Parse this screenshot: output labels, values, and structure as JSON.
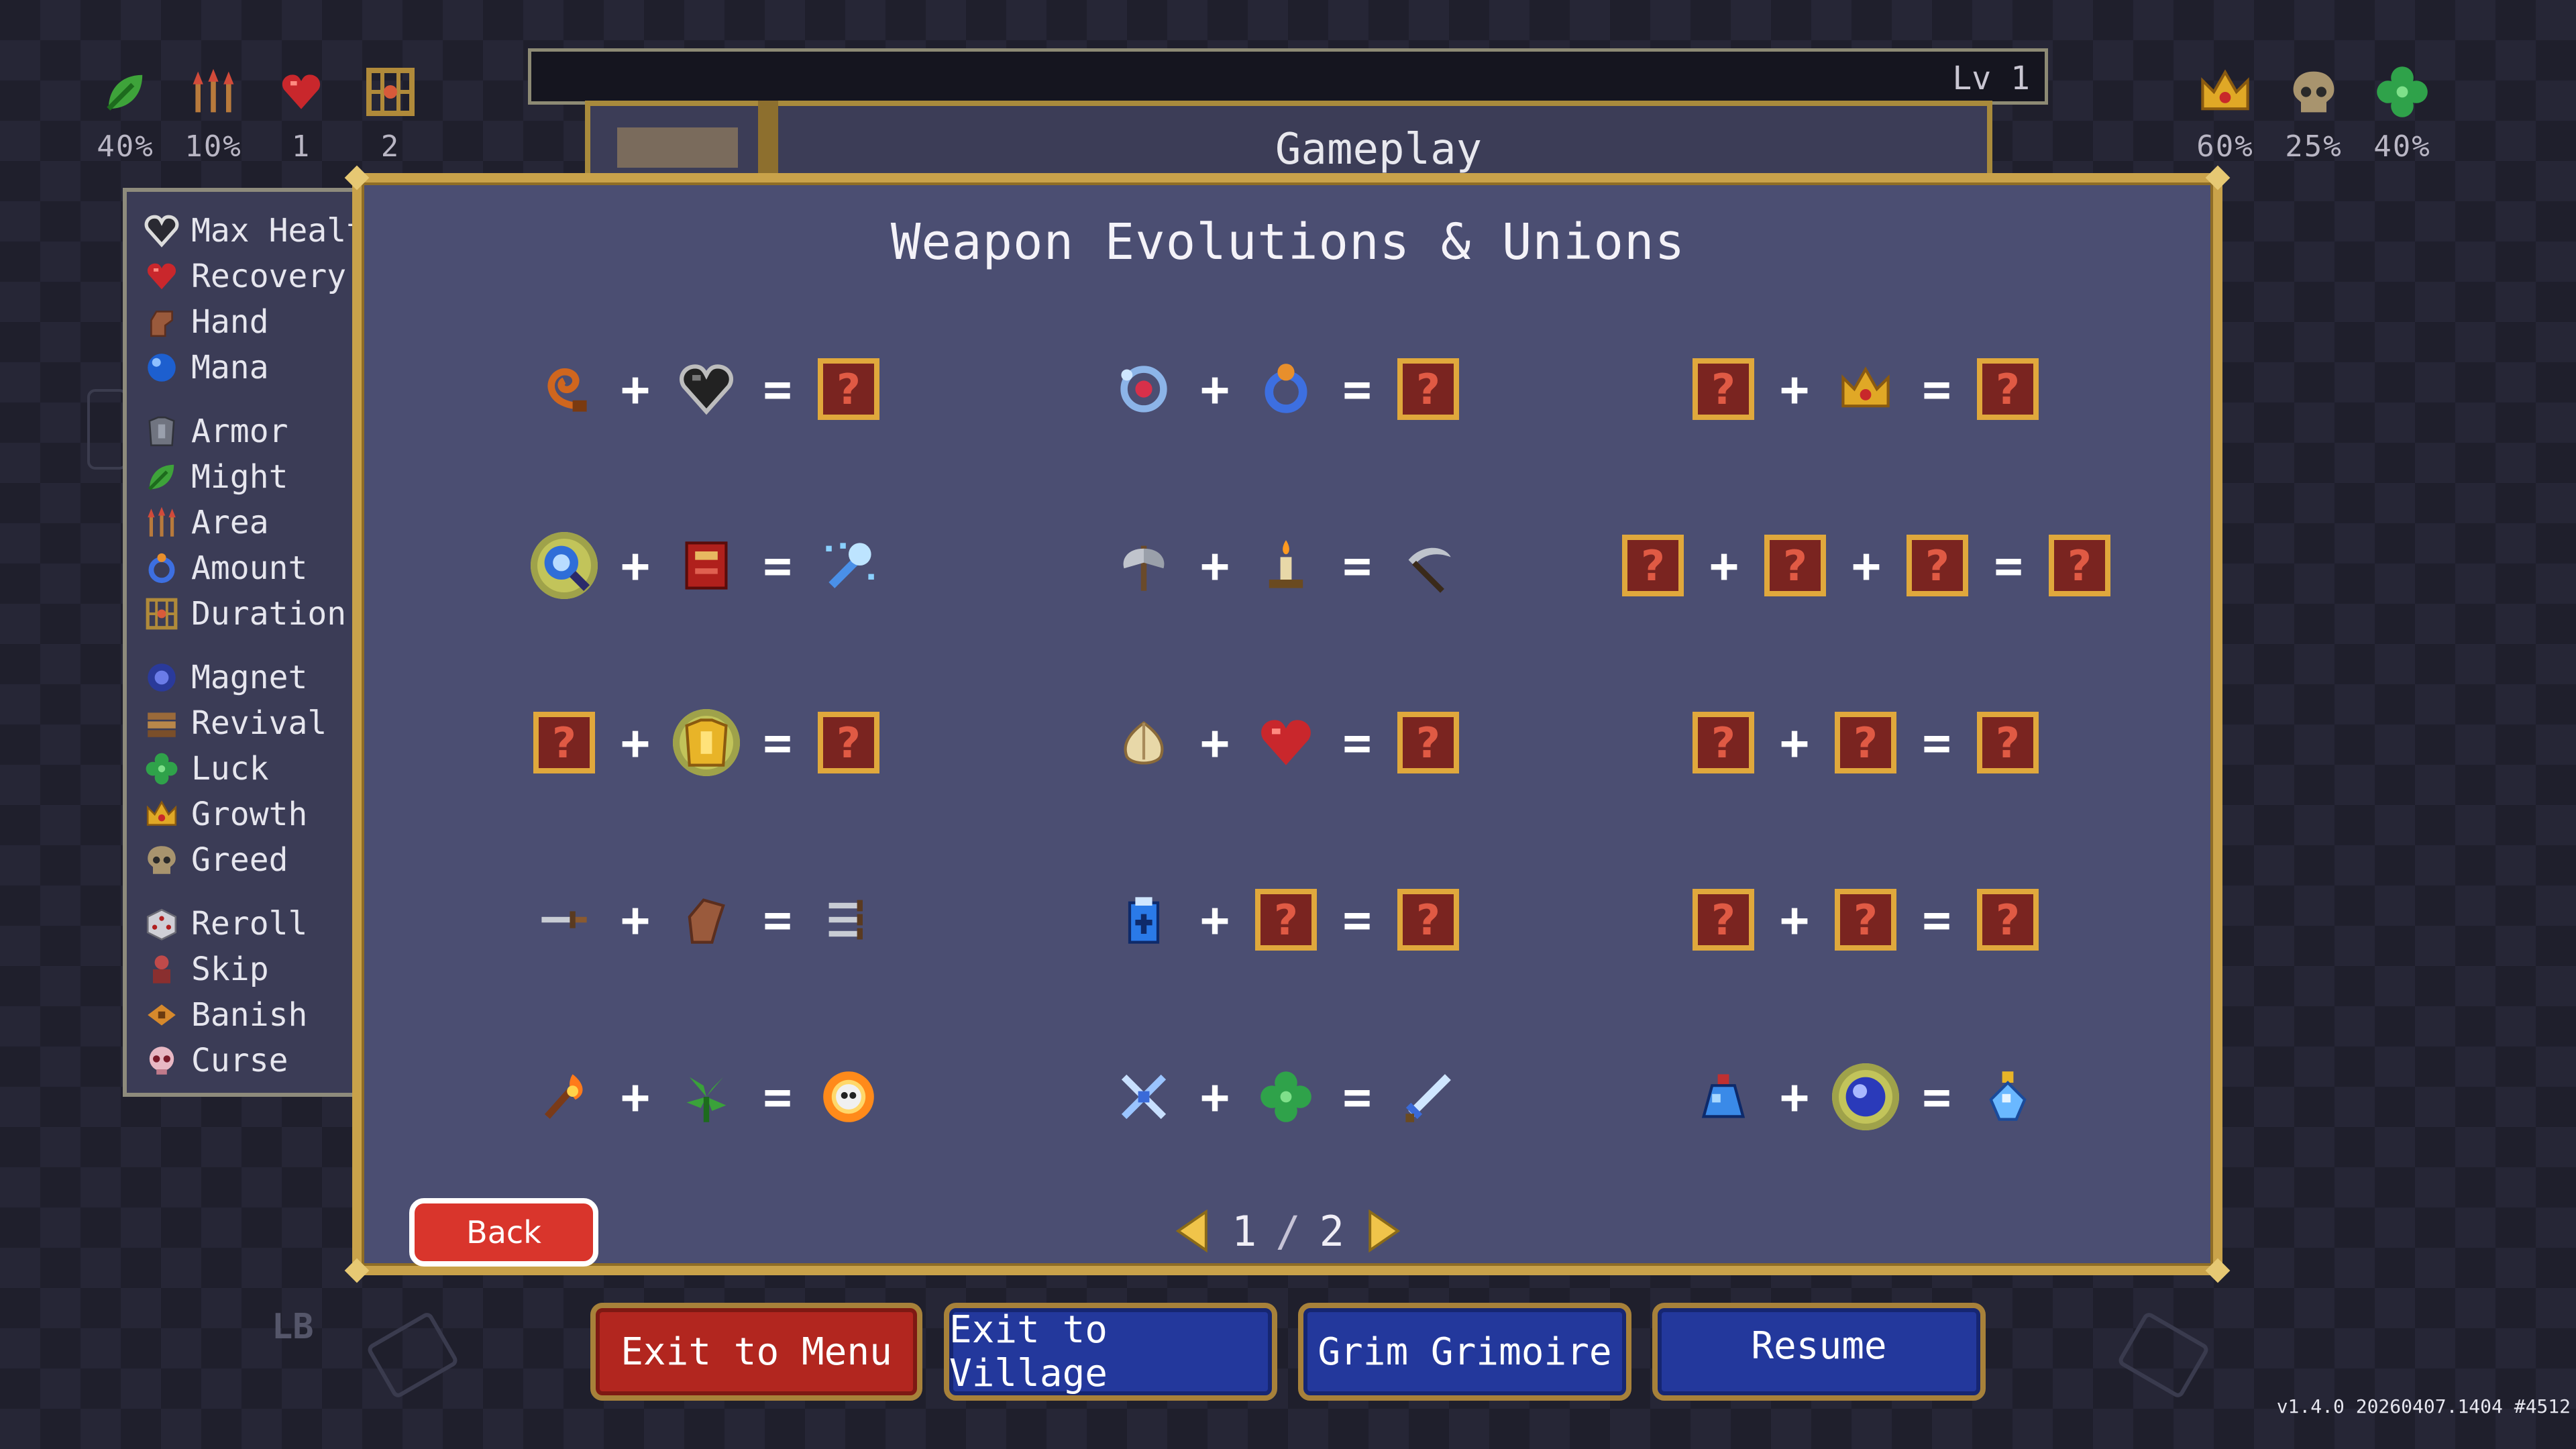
{
  "hud": {
    "left_stats": [
      {
        "icon": "leaf-icon",
        "value": "40%"
      },
      {
        "icon": "tridents-icon",
        "value": "10%"
      },
      {
        "icon": "heart-icon",
        "value": "1"
      },
      {
        "icon": "cage-icon",
        "value": "2"
      }
    ],
    "right_stats": [
      {
        "icon": "crown-icon",
        "value": "60%"
      },
      {
        "icon": "skull-icon",
        "value": "25%"
      },
      {
        "icon": "clover-icon",
        "value": "40%"
      }
    ],
    "level_label": "Lv 1"
  },
  "background_tab_title": "Gameplay",
  "stats_panel": {
    "items": [
      {
        "icon": "heart-outline-icon",
        "label": "Max Healt"
      },
      {
        "icon": "heart-icon",
        "label": "Recovery"
      },
      {
        "icon": "hand-icon",
        "label": "Hand"
      },
      {
        "icon": "mana-orb-icon",
        "label": "Mana"
      },
      {
        "icon": "armor-icon",
        "label": "Armor"
      },
      {
        "icon": "leaf-icon",
        "label": "Might"
      },
      {
        "icon": "tridents-icon",
        "label": "Area"
      },
      {
        "icon": "ring-icon",
        "label": "Amount"
      },
      {
        "icon": "cage-icon",
        "label": "Duration"
      },
      {
        "icon": "magnet-orb-icon",
        "label": "Magnet"
      },
      {
        "icon": "book-icon",
        "label": "Revival"
      },
      {
        "icon": "clover-icon",
        "label": "Luck"
      },
      {
        "icon": "crown-icon",
        "label": "Growth"
      },
      {
        "icon": "skull-icon",
        "label": "Greed"
      },
      {
        "icon": "dice-icon",
        "label": "Reroll"
      },
      {
        "icon": "skip-icon",
        "label": "Skip"
      },
      {
        "icon": "banish-icon",
        "label": "Banish"
      },
      {
        "icon": "curse-skull-icon",
        "label": "Curse"
      }
    ]
  },
  "modal": {
    "title": "Weapon Evolutions & Unions",
    "unknown_glyph": "?",
    "plus": "+",
    "equals": "=",
    "recipes": [
      [
        "whip-icon",
        "black-heart-icon",
        "unknown"
      ],
      [
        "orbit-ring-icon",
        "blue-ring-icon",
        "unknown"
      ],
      [
        "unknown",
        "crown-icon",
        "unknown"
      ],
      [
        "magic-wand-icon",
        "red-tome-icon",
        "holy-wand-icon"
      ],
      [
        "axe-icon",
        "candle-icon",
        "scythe-icon"
      ],
      [
        "unknown",
        "unknown",
        "unknown",
        "unknown"
      ],
      [
        "unknown",
        "golden-armor-icon",
        "unknown"
      ],
      [
        "garlic-icon",
        "heart-icon",
        "unknown"
      ],
      [
        "unknown",
        "unknown",
        "unknown"
      ],
      [
        "knife-icon",
        "gauntlet-icon",
        "triple-knife-icon"
      ],
      [
        "holy-water-icon",
        "unknown",
        "unknown"
      ],
      [
        "unknown",
        "unknown",
        "unknown"
      ],
      [
        "fire-wand-icon",
        "spinach-icon",
        "hellfire-skull-icon"
      ],
      [
        "cross-swords-icon",
        "clover-icon",
        "sword-icon"
      ],
      [
        "blue-potion-icon",
        "blue-orb-icon",
        "crystal-potion-icon"
      ]
    ],
    "highlighted": [
      "magic-wand-icon",
      "golden-armor-icon",
      "blue-orb-icon"
    ],
    "pager": {
      "current": "1",
      "separator": "/",
      "total": "2"
    },
    "back_label": "Back"
  },
  "menu_buttons": {
    "exit_menu": "Exit to Menu",
    "exit_village": "Exit to Village",
    "grimoire": "Grim Grimoire",
    "resume": "Resume"
  },
  "lb_label": "LB",
  "version": "v1.4.0 20260407.1404 #4512",
  "colors": {
    "modal_bg": "#4b4e72",
    "modal_border": "#c9a24a",
    "unknown_box": "#7a2420",
    "exit_menu_btn": "#b2261f",
    "blue_btn": "#23389c"
  }
}
